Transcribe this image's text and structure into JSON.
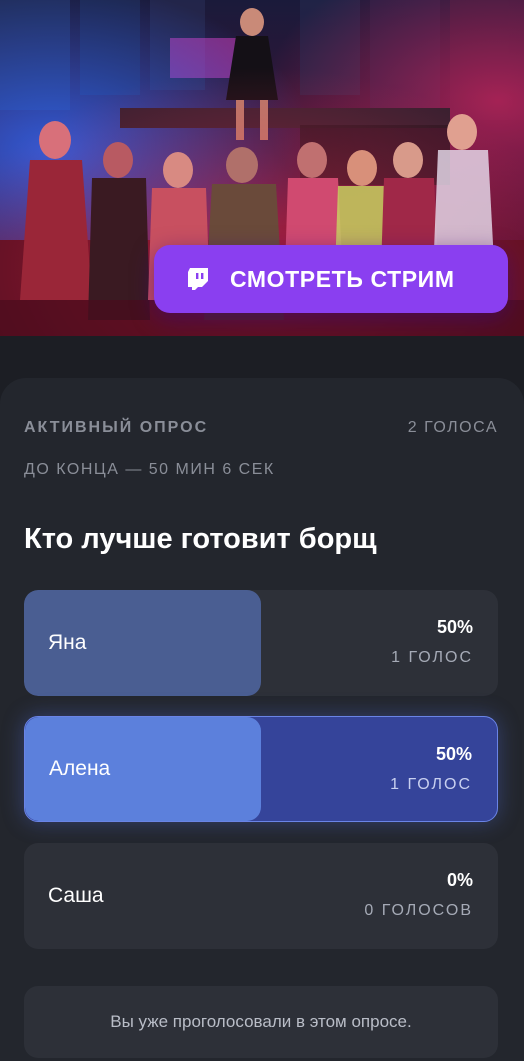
{
  "hero": {
    "image": "group-party-photo",
    "stream_button": {
      "icon": "twitch-icon",
      "label": "СМОТРЕТЬ СТРИМ",
      "color": "#8a3ff0"
    }
  },
  "poll": {
    "status_label": "АКТИВНЫЙ ОПРОС",
    "total_votes": "2 ГОЛОСА",
    "time_left": "ДО КОНЦА — 50 МИН 6 СЕК",
    "question": "Кто лучше готовит борщ",
    "options": [
      {
        "name": "Яна",
        "percent_label": "50%",
        "percent": 50,
        "votes": "1 ГОЛОС",
        "selected": false
      },
      {
        "name": "Алена",
        "percent_label": "50%",
        "percent": 50,
        "votes": "1 ГОЛОС",
        "selected": true
      },
      {
        "name": "Саша",
        "percent_label": "0%",
        "percent": 0,
        "votes": "0 ГОЛОСОВ",
        "selected": false
      }
    ],
    "voted_notice": "Вы уже проголосовали в этом опросе."
  },
  "colors": {
    "background": "#1c1e24",
    "card": "#23262d",
    "option_bg": "#2d3038",
    "option_fill": "#4a5e92",
    "selected_fill": "#5c80dc",
    "selected_bg": "#35449a",
    "muted_text": "#8a8e98"
  }
}
